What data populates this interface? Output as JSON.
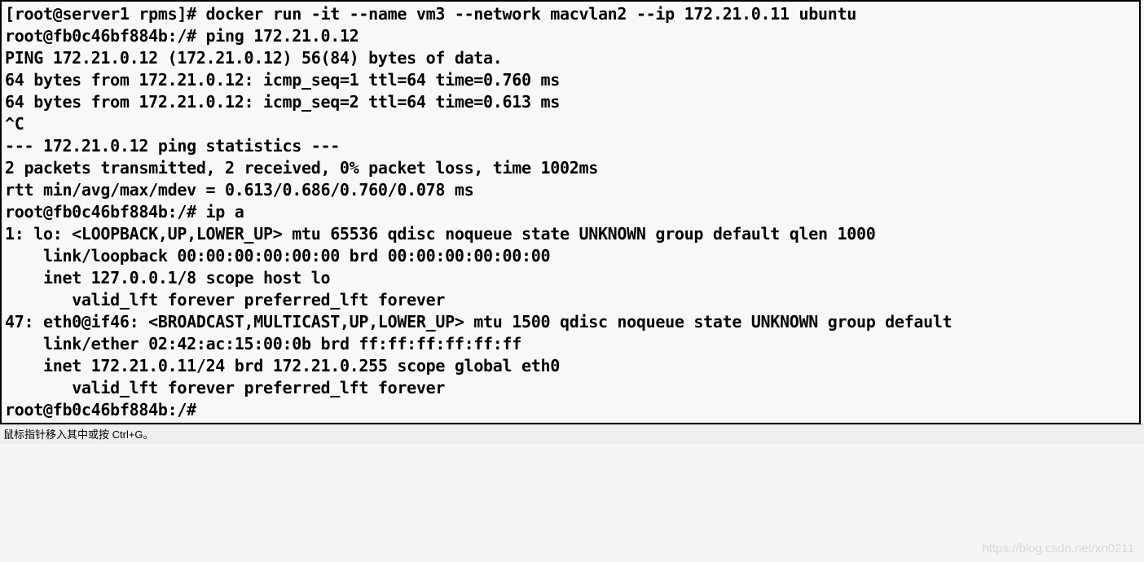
{
  "terminal": {
    "lines": [
      "[root@server1 rpms]# docker run -it --name vm3 --network macvlan2 --ip 172.21.0.11 ubuntu",
      "root@fb0c46bf884b:/# ping 172.21.0.12",
      "PING 172.21.0.12 (172.21.0.12) 56(84) bytes of data.",
      "64 bytes from 172.21.0.12: icmp_seq=1 ttl=64 time=0.760 ms",
      "64 bytes from 172.21.0.12: icmp_seq=2 ttl=64 time=0.613 ms",
      "^C",
      "--- 172.21.0.12 ping statistics ---",
      "2 packets transmitted, 2 received, 0% packet loss, time 1002ms",
      "rtt min/avg/max/mdev = 0.613/0.686/0.760/0.078 ms",
      "root@fb0c46bf884b:/# ip a",
      "1: lo: <LOOPBACK,UP,LOWER_UP> mtu 65536 qdisc noqueue state UNKNOWN group default qlen 1000",
      "    link/loopback 00:00:00:00:00:00 brd 00:00:00:00:00:00",
      "    inet 127.0.0.1/8 scope host lo",
      "       valid_lft forever preferred_lft forever",
      "47: eth0@if46: <BROADCAST,MULTICAST,UP,LOWER_UP> mtu 1500 qdisc noqueue state UNKNOWN group default ",
      "    link/ether 02:42:ac:15:00:0b brd ff:ff:ff:ff:ff:ff",
      "    inet 172.21.0.11/24 brd 172.21.0.255 scope global eth0",
      "       valid_lft forever preferred_lft forever",
      "root@fb0c46bf884b:/# "
    ]
  },
  "status_bar": {
    "text": "鼠标指针移入其中或按 Ctrl+G。"
  },
  "watermark": {
    "text": "https://blog.csdn.net/xn0211"
  }
}
